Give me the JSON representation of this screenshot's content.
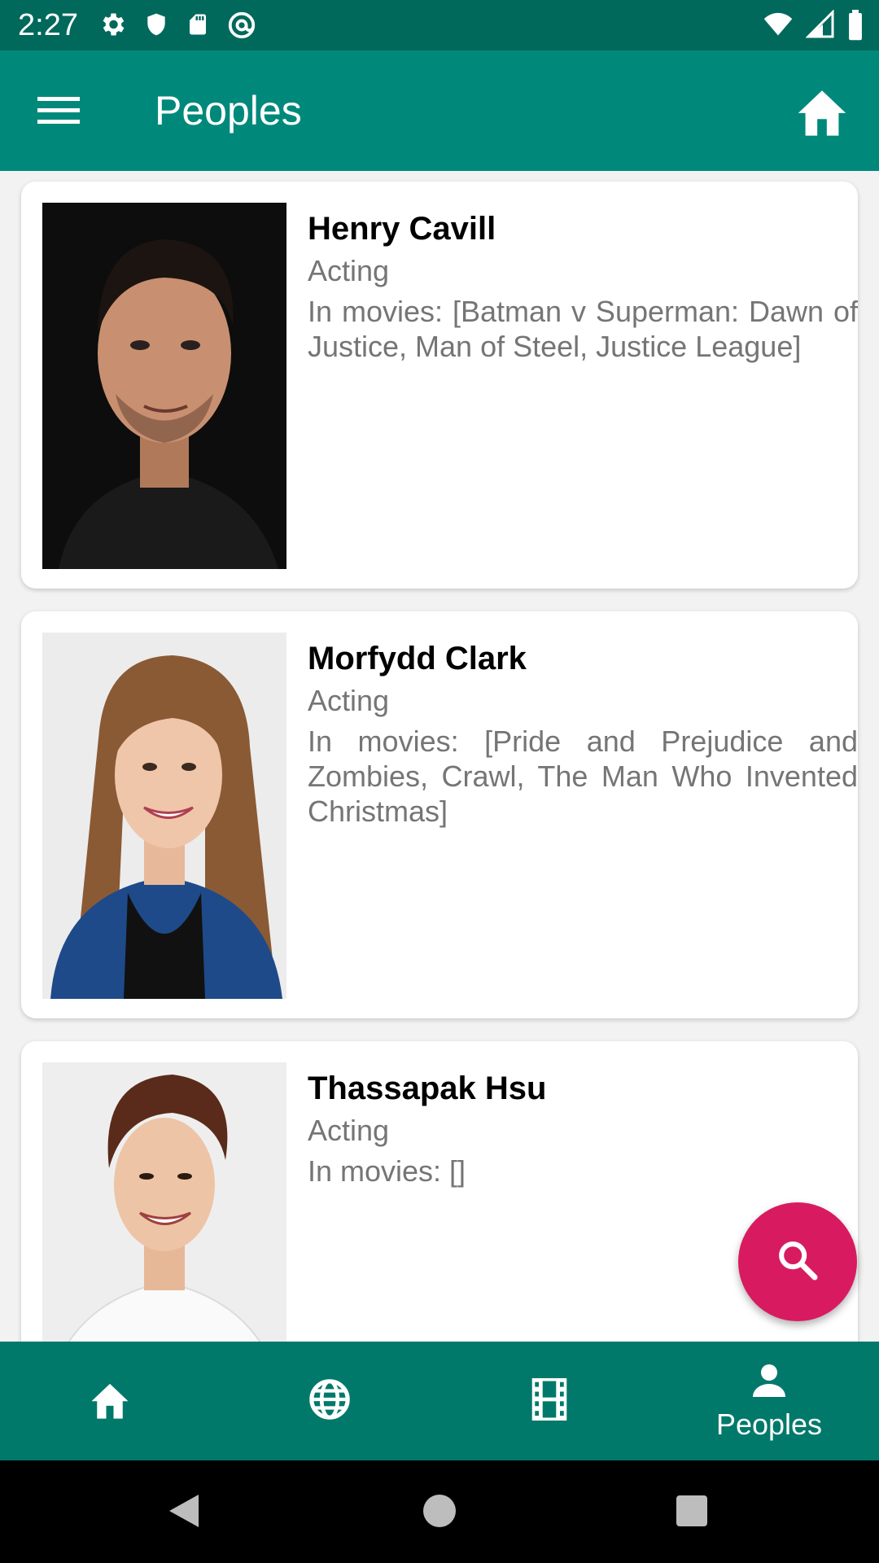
{
  "status_bar": {
    "time": "2:27",
    "left_icons": [
      "gear-icon",
      "shield-icon",
      "sd-card-icon",
      "at-sign-icon"
    ],
    "right_icons": [
      "wifi-icon",
      "signal-icon",
      "battery-icon"
    ]
  },
  "app_bar": {
    "title": "Peoples",
    "menu_icon": "hamburger-menu-icon",
    "action_icon": "home-icon"
  },
  "people": [
    {
      "name": "Henry Cavill",
      "department": "Acting",
      "movies": "In movies: [Batman v Superman: Dawn of Justice, Man of Steel, Justice League]"
    },
    {
      "name": "Morfydd Clark",
      "department": "Acting",
      "movies": "In movies: [Pride and Prejudice and Zombies, Crawl, The Man Who Invented Christmas]"
    },
    {
      "name": "Thassapak Hsu",
      "department": "Acting",
      "movies": "In movies: []"
    }
  ],
  "fab": {
    "icon": "search-icon"
  },
  "bottom_nav": {
    "items": [
      {
        "icon": "home-icon",
        "label": ""
      },
      {
        "icon": "globe-icon",
        "label": ""
      },
      {
        "icon": "film-icon",
        "label": ""
      },
      {
        "icon": "person-icon",
        "label": "Peoples",
        "selected": true
      }
    ]
  },
  "colors": {
    "status_bar": "#00695c",
    "app_bar": "#00897b",
    "bottom_nav": "#00796b",
    "fab": "#d81b60"
  }
}
